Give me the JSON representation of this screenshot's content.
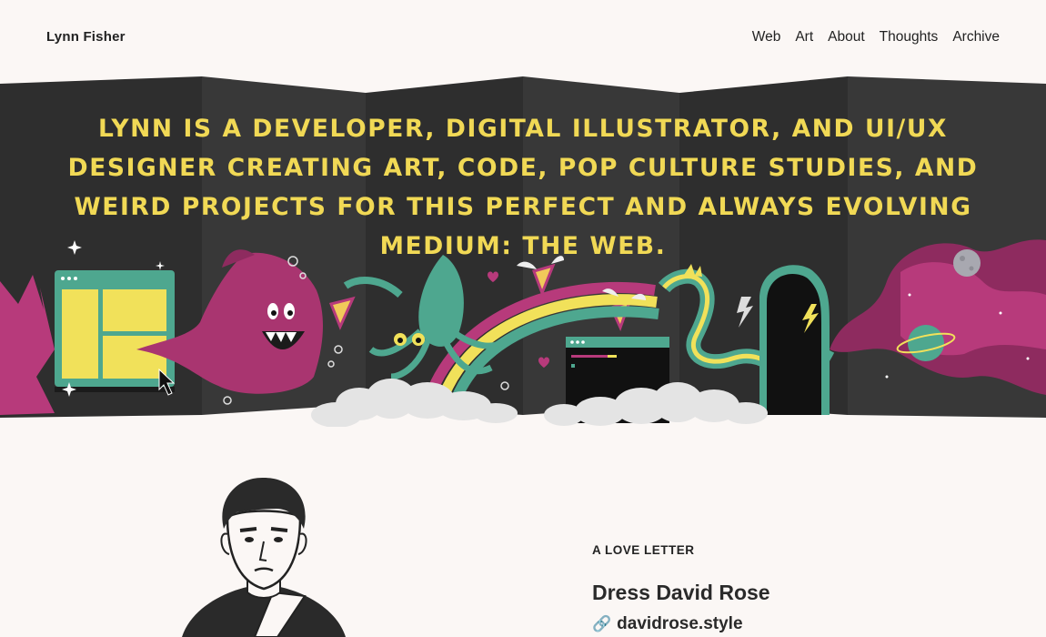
{
  "site": {
    "title": "Lynn Fisher"
  },
  "nav": {
    "items": [
      {
        "label": "Web"
      },
      {
        "label": "Art"
      },
      {
        "label": "About"
      },
      {
        "label": "Thoughts"
      },
      {
        "label": "Archive"
      }
    ]
  },
  "hero": {
    "tagline": "Lynn is a developer, digital illustrator, and UI/UX designer creating art, code, pop culture studies, and weird projects for this perfect and always evolving medium: the web.",
    "colors": {
      "background": "#2f2f2f",
      "text": "#f1d955",
      "magenta": "#b73a7b",
      "teal": "#4ea78f",
      "yellow": "#f1e15a"
    }
  },
  "feature": {
    "eyebrow": "A LOVE LETTER",
    "title": "Dress David Rose",
    "link_icon": "link-icon",
    "link_text": "davidrose.style"
  }
}
